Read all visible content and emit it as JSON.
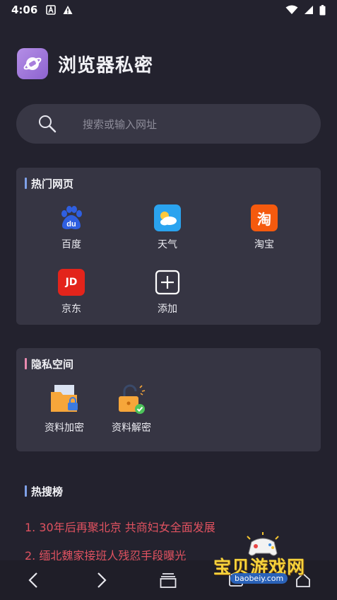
{
  "status_bar": {
    "time": "4:06"
  },
  "app": {
    "title": "浏览器私密"
  },
  "search": {
    "placeholder": "搜索或输入网址"
  },
  "hot_sites": {
    "title": "热门网页",
    "items": [
      {
        "label": "百度",
        "icon": "baidu-icon"
      },
      {
        "label": "天气",
        "icon": "weather-icon"
      },
      {
        "label": "淘宝",
        "icon": "taobao-icon",
        "glyph": "淘"
      },
      {
        "label": "京东",
        "icon": "jd-icon",
        "glyph": "JD"
      },
      {
        "label": "添加",
        "icon": "add-icon"
      }
    ]
  },
  "private_space": {
    "title": "隐私空间",
    "items": [
      {
        "label": "资料加密",
        "icon": "folder-lock-icon"
      },
      {
        "label": "资料解密",
        "icon": "unlock-icon"
      }
    ]
  },
  "hot_search": {
    "title": "热搜榜",
    "items": [
      "1. 30年后再聚北京 共商妇女全面发展",
      "2. 缅北魏家接班人残忍手段曝光"
    ]
  },
  "watermark": {
    "text": "宝贝游戏网",
    "url": "baobeiy.com"
  },
  "colors": {
    "background": "#23222e",
    "card": "#363543",
    "hot_text": "#e05260"
  }
}
